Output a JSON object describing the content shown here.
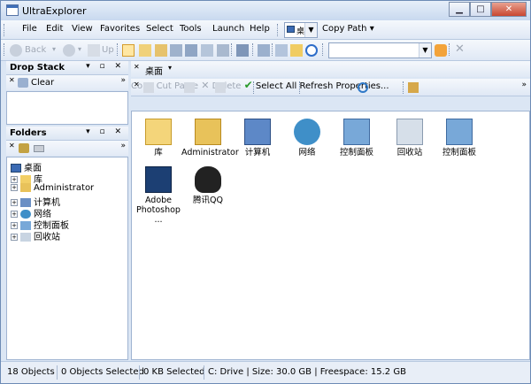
{
  "window": {
    "title": "UltraExplorer"
  },
  "menu": {
    "file": "File",
    "edit": "Edit",
    "view": "View",
    "favorites": "Favorites",
    "select": "Select",
    "tools": "Tools",
    "launch": "Launch",
    "help": "Help",
    "location": "桌面",
    "copy_path": "Copy Path"
  },
  "nav": {
    "back": "Back",
    "up": "Up"
  },
  "drop_stack": {
    "title": "Drop Stack",
    "clear": "Clear"
  },
  "folders": {
    "title": "Folders",
    "root": "桌面",
    "items": [
      {
        "label": "库"
      },
      {
        "label": "Administrator"
      },
      {
        "label": "计算机"
      },
      {
        "label": "网络"
      },
      {
        "label": "控制面板"
      },
      {
        "label": "回收站"
      }
    ]
  },
  "breadcrumb": {
    "location": "桌面"
  },
  "actions": {
    "copy": "Copy",
    "cut": "Cut",
    "paste": "Paste",
    "delete": "Delete",
    "select_all": "Select All",
    "refresh": "Refresh",
    "properties": "Properties..."
  },
  "files": [
    {
      "label": "库",
      "icon": "library-icon"
    },
    {
      "label": "Administrator",
      "icon": "user-folder-icon"
    },
    {
      "label": "计算机",
      "icon": "computer-icon"
    },
    {
      "label": "网络",
      "icon": "network-icon"
    },
    {
      "label": "控制面板",
      "icon": "control-panel-icon"
    },
    {
      "label": "回收站",
      "icon": "recycle-bin-icon"
    },
    {
      "label": "控制面板",
      "icon": "control-panel-icon"
    },
    {
      "label": "Adobe Photoshop ...",
      "icon": "photoshop-icon"
    },
    {
      "label": "腾讯QQ",
      "icon": "qq-icon"
    }
  ],
  "status": {
    "objects": "18 Objects",
    "selected": "0 Objects Selected",
    "size_selected": "0 KB Selected",
    "drive": "C: Drive | Size: 30.0 GB | Freespace: 15.2 GB"
  }
}
